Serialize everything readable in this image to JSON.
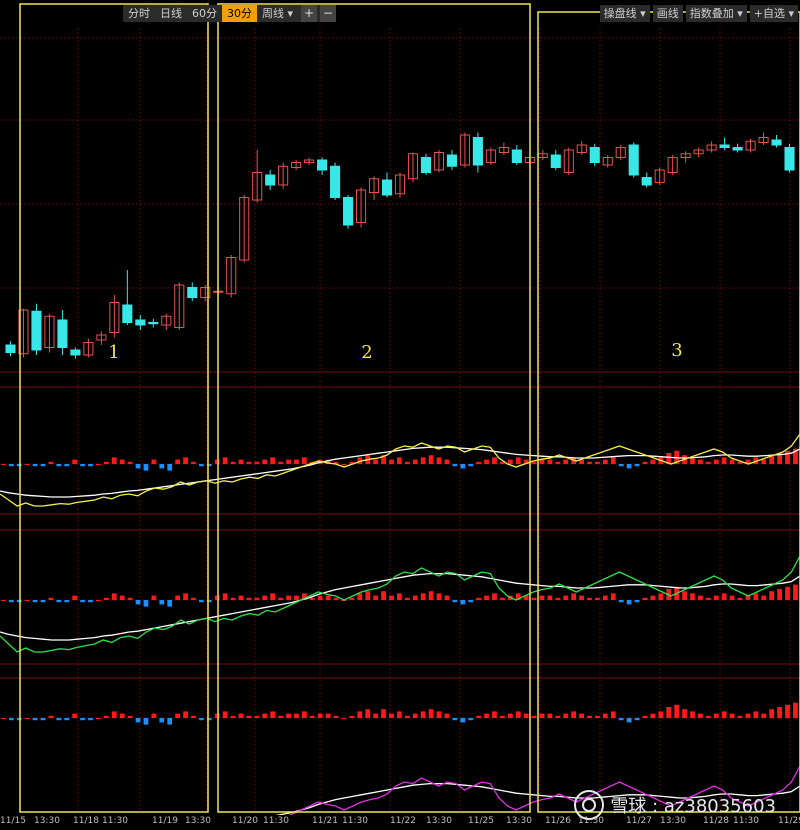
{
  "toolbar_left": [
    "分时",
    "日线",
    "60分",
    "30分",
    "周线 ▾"
  ],
  "toolbar_left_active": "30分",
  "toolbar_icons": [
    "+",
    "−"
  ],
  "toolbar_right": [
    "操盘线 ▾",
    "画线",
    "指数叠加 ▾",
    "+自选 ▾"
  ],
  "region_labels": [
    "1",
    "2",
    "3"
  ],
  "time_labels": [
    "11/15",
    "13:30",
    "11/18",
    "11:30",
    "11/19",
    "13:30",
    "11/20",
    "11:30",
    "11/21",
    "11:30",
    "11/22",
    "13:30",
    "11/25",
    "13:30",
    "11/26",
    "11:30",
    "11/27",
    "13:30",
    "11/28",
    "11:30",
    "11/29"
  ],
  "watermark": "雪球 : az38035603",
  "colors": {
    "bg": "#000000",
    "grid": "#5a0a0a",
    "candle_down": "#38e8e8",
    "candle_up": "#e85050",
    "highlight_box": "#f2e64b",
    "macd_up": "#ff1a1a",
    "macd_down": "#1a8fff",
    "dif1": "#f2ee4b",
    "dif2": "#2ee04a",
    "dif3": "#e02ee0",
    "dea": "#ffffff"
  },
  "chart_data": {
    "type": "candlestick",
    "candles": [
      {
        "o": 112,
        "c": 106,
        "h": 115,
        "l": 103
      },
      {
        "o": 105,
        "c": 140,
        "h": 141,
        "l": 102
      },
      {
        "o": 139,
        "c": 108,
        "h": 145,
        "l": 104
      },
      {
        "o": 110,
        "c": 135,
        "h": 137,
        "l": 106
      },
      {
        "o": 132,
        "c": 110,
        "h": 140,
        "l": 104
      },
      {
        "o": 108,
        "c": 104,
        "h": 110,
        "l": 101
      },
      {
        "o": 104,
        "c": 114,
        "h": 117,
        "l": 102
      },
      {
        "o": 116,
        "c": 120,
        "h": 123,
        "l": 112
      },
      {
        "o": 122,
        "c": 146,
        "h": 152,
        "l": 118
      },
      {
        "o": 144,
        "c": 130,
        "h": 172,
        "l": 128
      },
      {
        "o": 132,
        "c": 128,
        "h": 136,
        "l": 124
      },
      {
        "o": 130,
        "c": 129,
        "h": 133,
        "l": 126
      },
      {
        "o": 128,
        "c": 135,
        "h": 137,
        "l": 124
      },
      {
        "o": 126,
        "c": 160,
        "h": 162,
        "l": 124
      },
      {
        "o": 158,
        "c": 150,
        "h": 162,
        "l": 147
      },
      {
        "o": 150,
        "c": 158,
        "h": 160,
        "l": 147
      },
      {
        "o": 155,
        "c": 155,
        "h": 158,
        "l": 152
      },
      {
        "o": 153,
        "c": 182,
        "h": 184,
        "l": 150
      },
      {
        "o": 180,
        "c": 230,
        "h": 232,
        "l": 178
      },
      {
        "o": 228,
        "c": 250,
        "h": 268,
        "l": 226
      },
      {
        "o": 248,
        "c": 240,
        "h": 252,
        "l": 236
      },
      {
        "o": 240,
        "c": 255,
        "h": 258,
        "l": 237
      },
      {
        "o": 254,
        "c": 258,
        "h": 260,
        "l": 252
      },
      {
        "o": 258,
        "c": 260,
        "h": 262,
        "l": 256
      },
      {
        "o": 260,
        "c": 252,
        "h": 262,
        "l": 248
      },
      {
        "o": 255,
        "c": 230,
        "h": 258,
        "l": 228
      },
      {
        "o": 230,
        "c": 208,
        "h": 232,
        "l": 205
      },
      {
        "o": 210,
        "c": 236,
        "h": 238,
        "l": 206
      },
      {
        "o": 234,
        "c": 245,
        "h": 247,
        "l": 228
      },
      {
        "o": 244,
        "c": 232,
        "h": 250,
        "l": 230
      },
      {
        "o": 233,
        "c": 248,
        "h": 250,
        "l": 230
      },
      {
        "o": 245,
        "c": 265,
        "h": 266,
        "l": 242
      },
      {
        "o": 262,
        "c": 250,
        "h": 265,
        "l": 248
      },
      {
        "o": 252,
        "c": 266,
        "h": 268,
        "l": 250
      },
      {
        "o": 264,
        "c": 255,
        "h": 268,
        "l": 252
      },
      {
        "o": 256,
        "c": 280,
        "h": 282,
        "l": 254
      },
      {
        "o": 278,
        "c": 256,
        "h": 282,
        "l": 250
      },
      {
        "o": 258,
        "c": 268,
        "h": 270,
        "l": 256
      },
      {
        "o": 266,
        "c": 270,
        "h": 274,
        "l": 264
      },
      {
        "o": 268,
        "c": 258,
        "h": 272,
        "l": 256
      },
      {
        "o": 258,
        "c": 262,
        "h": 264,
        "l": 256
      },
      {
        "o": 262,
        "c": 265,
        "h": 268,
        "l": 260
      },
      {
        "o": 264,
        "c": 254,
        "h": 268,
        "l": 252
      },
      {
        "o": 250,
        "c": 268,
        "h": 270,
        "l": 248
      },
      {
        "o": 266,
        "c": 272,
        "h": 275,
        "l": 264
      },
      {
        "o": 270,
        "c": 258,
        "h": 273,
        "l": 255
      },
      {
        "o": 256,
        "c": 262,
        "h": 264,
        "l": 254
      },
      {
        "o": 262,
        "c": 270,
        "h": 272,
        "l": 260
      },
      {
        "o": 272,
        "c": 248,
        "h": 274,
        "l": 246
      },
      {
        "o": 246,
        "c": 240,
        "h": 250,
        "l": 238
      },
      {
        "o": 242,
        "c": 252,
        "h": 254,
        "l": 240
      },
      {
        "o": 250,
        "c": 262,
        "h": 264,
        "l": 248
      },
      {
        "o": 262,
        "c": 265,
        "h": 267,
        "l": 258
      },
      {
        "o": 265,
        "c": 268,
        "h": 270,
        "l": 262
      },
      {
        "o": 268,
        "c": 272,
        "h": 275,
        "l": 266
      },
      {
        "o": 272,
        "c": 270,
        "h": 278,
        "l": 268
      },
      {
        "o": 270,
        "c": 268,
        "h": 273,
        "l": 266
      },
      {
        "o": 268,
        "c": 275,
        "h": 277,
        "l": 266
      },
      {
        "o": 274,
        "c": 278,
        "h": 282,
        "l": 272
      },
      {
        "o": 276,
        "c": 272,
        "h": 280,
        "l": 270
      },
      {
        "o": 270,
        "c": 252,
        "h": 273,
        "l": 250
      }
    ],
    "macd_bars": [
      0,
      -1,
      -1,
      0,
      -1,
      -1,
      1,
      -1,
      -1,
      2,
      -1,
      -1,
      0,
      1,
      3,
      2,
      1,
      -2,
      -3,
      2,
      -2,
      -3,
      2,
      3,
      1,
      -1,
      -1,
      2,
      3,
      1,
      2,
      1,
      1,
      2,
      3,
      1,
      2,
      2,
      3,
      1,
      2,
      2,
      1,
      0,
      1,
      3,
      4,
      2,
      4,
      2,
      3,
      1,
      2,
      3,
      4,
      3,
      2,
      -1,
      -2,
      -1,
      1,
      2,
      3,
      1,
      2,
      3,
      2,
      1,
      2,
      2,
      1,
      2,
      3,
      2,
      1,
      1,
      2,
      3,
      -1,
      -2,
      -1,
      1,
      2,
      3,
      5,
      6,
      4,
      3,
      2,
      1,
      2,
      3,
      2,
      1,
      2,
      3,
      2,
      4,
      5,
      6,
      7
    ],
    "dif1": [
      0.5,
      0.4,
      0.3,
      0.35,
      0.3,
      0.3,
      0.32,
      0.34,
      0.33,
      0.36,
      0.38,
      0.4,
      0.45,
      0.42,
      0.48,
      0.5,
      0.47,
      0.55,
      0.6,
      0.58,
      0.62,
      0.7,
      0.65,
      0.7,
      0.72,
      0.68,
      0.72,
      0.7,
      0.75,
      0.78,
      0.76,
      0.82,
      0.8,
      0.85,
      0.9,
      0.95,
      1.0,
      1.05,
      1.02,
      1.0,
      0.95,
      1.0,
      1.05,
      1.08,
      1.1,
      1.15,
      1.25,
      1.3,
      1.28,
      1.35,
      1.3,
      1.25,
      1.3,
      1.28,
      1.2,
      1.25,
      1.3,
      1.28,
      1.1,
      1.0,
      0.95,
      1.0,
      1.05,
      1.08,
      1.1,
      1.15,
      1.1,
      1.05,
      1.1,
      1.15,
      1.2,
      1.25,
      1.3,
      1.25,
      1.2,
      1.15,
      1.1,
      1.05,
      1.0,
      1.05,
      1.1,
      1.15,
      1.2,
      1.25,
      1.2,
      1.1,
      1.05,
      1.0,
      1.05,
      1.1,
      1.15,
      1.2,
      1.3,
      1.5
    ],
    "dea1": [
      0.55,
      0.52,
      0.5,
      0.48,
      0.47,
      0.46,
      0.45,
      0.45,
      0.45,
      0.46,
      0.47,
      0.48,
      0.5,
      0.51,
      0.53,
      0.55,
      0.56,
      0.58,
      0.6,
      0.62,
      0.64,
      0.66,
      0.68,
      0.7,
      0.72,
      0.74,
      0.76,
      0.78,
      0.8,
      0.82,
      0.84,
      0.86,
      0.88,
      0.9,
      0.92,
      0.95,
      0.98,
      1.02,
      1.05,
      1.08,
      1.1,
      1.12,
      1.14,
      1.16,
      1.18,
      1.2,
      1.22,
      1.24,
      1.26,
      1.27,
      1.28,
      1.28,
      1.28,
      1.27,
      1.26,
      1.25,
      1.24,
      1.22,
      1.2,
      1.18,
      1.16,
      1.15,
      1.14,
      1.13,
      1.12,
      1.12,
      1.11,
      1.1,
      1.1,
      1.1,
      1.11,
      1.12,
      1.13,
      1.14,
      1.14,
      1.14,
      1.13,
      1.12,
      1.11,
      1.1,
      1.1,
      1.11,
      1.12,
      1.14,
      1.15,
      1.15,
      1.14,
      1.13,
      1.13,
      1.14,
      1.15,
      1.16,
      1.18,
      1.25
    ]
  }
}
